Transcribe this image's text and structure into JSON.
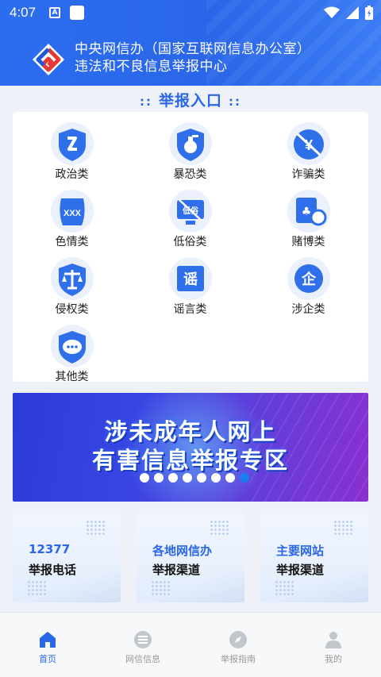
{
  "status": {
    "time": "4:07",
    "a_badge": "A"
  },
  "header": {
    "line1": "中央网信办（国家互联网信息办公室）",
    "line2": "违法和不良信息举报中心"
  },
  "section": {
    "title": "举报入口",
    "deco": "::"
  },
  "categories": [
    {
      "label": "政治类",
      "icon": "politics-icon"
    },
    {
      "label": "暴恐类",
      "icon": "grenade-icon"
    },
    {
      "label": "诈骗类",
      "icon": "fraud-icon"
    },
    {
      "label": "色情类",
      "icon": "porn-icon"
    },
    {
      "label": "低俗类",
      "icon": "vulgar-icon"
    },
    {
      "label": "赌博类",
      "icon": "gambling-icon"
    },
    {
      "label": "侵权类",
      "icon": "scales-icon"
    },
    {
      "label": "谣言类",
      "icon": "rumor-icon"
    },
    {
      "label": "涉企类",
      "icon": "enterprise-icon"
    },
    {
      "label": "其他类",
      "icon": "chat-icon"
    }
  ],
  "banner": {
    "line1": "涉未成年人网上",
    "line2": "有害信息举报专区"
  },
  "quick": [
    {
      "line1": "12377",
      "line2": "举报电话"
    },
    {
      "line1": "各地网信办",
      "line2": "举报渠道"
    },
    {
      "line1": "主要网站",
      "line2": "举报渠道"
    }
  ],
  "nav": [
    {
      "label": "首页",
      "icon": "home-icon",
      "active": true
    },
    {
      "label": "网信信息",
      "icon": "list-icon",
      "active": false
    },
    {
      "label": "举报指南",
      "icon": "compass-icon",
      "active": false
    },
    {
      "label": "我的",
      "icon": "user-icon",
      "active": false
    }
  ],
  "colors": {
    "accent": "#2a66e8",
    "header_bg": "#2c6df0",
    "nav_inactive": "#999999"
  }
}
